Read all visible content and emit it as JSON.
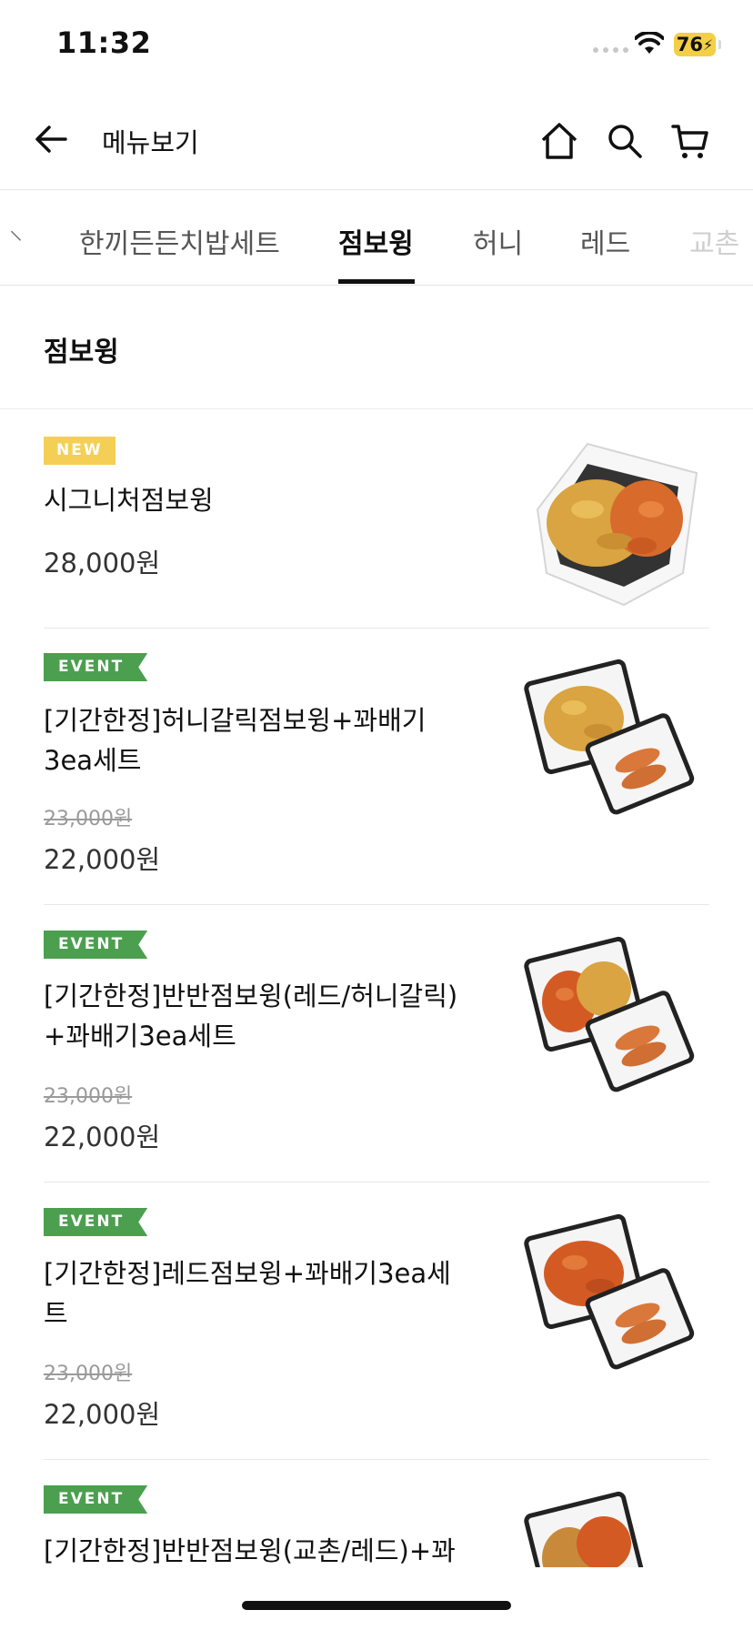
{
  "status_bar": {
    "time": "11:32",
    "battery": "76"
  },
  "header": {
    "title": "메뉴보기",
    "icons": [
      "back-arrow-icon",
      "home-icon",
      "search-icon",
      "cart-icon"
    ]
  },
  "tabs": [
    {
      "label": "",
      "state": "partial"
    },
    {
      "label": "한끼든든치밥세트",
      "state": "normal"
    },
    {
      "label": "점보윙",
      "state": "active"
    },
    {
      "label": "허니",
      "state": "normal"
    },
    {
      "label": "레드",
      "state": "normal"
    },
    {
      "label": "교촌",
      "state": "faded"
    }
  ],
  "section": {
    "title": "점보윙"
  },
  "items": [
    {
      "badge": "NEW",
      "name_lines": [
        "시그니처점보윙"
      ],
      "old_price": "",
      "price": "28,000원"
    },
    {
      "badge": "EVENT",
      "name_lines": [
        "[기간한정]허니갈릭점보윙+꽈배기",
        "3ea세트"
      ],
      "old_price": "23,000원",
      "price": "22,000원"
    },
    {
      "badge": "EVENT",
      "name_lines": [
        "[기간한정]반반점보윙(레드/허니갈릭)",
        "+꽈배기3ea세트"
      ],
      "old_price": "23,000원",
      "price": "22,000원"
    },
    {
      "badge": "EVENT",
      "name_lines": [
        "[기간한정]레드점보윙+꽈배기3ea세",
        "트"
      ],
      "old_price": "23,000원",
      "price": "22,000원"
    },
    {
      "badge": "EVENT",
      "name_lines": [
        "[기간한정]반반점보윙(교촌/레드)+꽈"
      ],
      "old_price": "",
      "price": ""
    }
  ],
  "colors": {
    "new_badge": "#f3cf55",
    "event_badge": "#4c9f4f",
    "battery": "#f3cf45"
  }
}
